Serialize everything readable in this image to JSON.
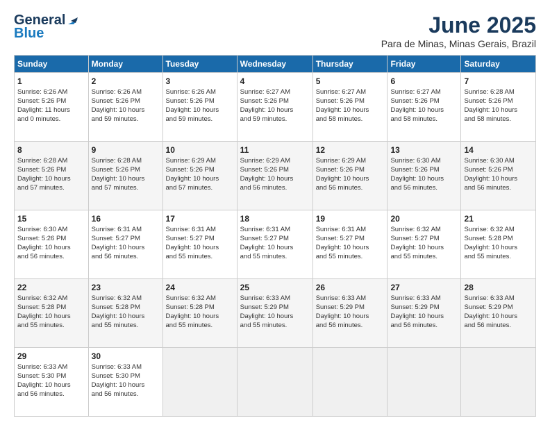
{
  "header": {
    "logo_line1": "General",
    "logo_line2": "Blue",
    "month": "June 2025",
    "location": "Para de Minas, Minas Gerais, Brazil"
  },
  "days_of_week": [
    "Sunday",
    "Monday",
    "Tuesday",
    "Wednesday",
    "Thursday",
    "Friday",
    "Saturday"
  ],
  "weeks": [
    [
      {
        "day": "1",
        "lines": [
          "Sunrise: 6:26 AM",
          "Sunset: 5:26 PM",
          "Daylight: 11 hours",
          "and 0 minutes."
        ]
      },
      {
        "day": "2",
        "lines": [
          "Sunrise: 6:26 AM",
          "Sunset: 5:26 PM",
          "Daylight: 10 hours",
          "and 59 minutes."
        ]
      },
      {
        "day": "3",
        "lines": [
          "Sunrise: 6:26 AM",
          "Sunset: 5:26 PM",
          "Daylight: 10 hours",
          "and 59 minutes."
        ]
      },
      {
        "day": "4",
        "lines": [
          "Sunrise: 6:27 AM",
          "Sunset: 5:26 PM",
          "Daylight: 10 hours",
          "and 59 minutes."
        ]
      },
      {
        "day": "5",
        "lines": [
          "Sunrise: 6:27 AM",
          "Sunset: 5:26 PM",
          "Daylight: 10 hours",
          "and 58 minutes."
        ]
      },
      {
        "day": "6",
        "lines": [
          "Sunrise: 6:27 AM",
          "Sunset: 5:26 PM",
          "Daylight: 10 hours",
          "and 58 minutes."
        ]
      },
      {
        "day": "7",
        "lines": [
          "Sunrise: 6:28 AM",
          "Sunset: 5:26 PM",
          "Daylight: 10 hours",
          "and 58 minutes."
        ]
      }
    ],
    [
      {
        "day": "8",
        "lines": [
          "Sunrise: 6:28 AM",
          "Sunset: 5:26 PM",
          "Daylight: 10 hours",
          "and 57 minutes."
        ]
      },
      {
        "day": "9",
        "lines": [
          "Sunrise: 6:28 AM",
          "Sunset: 5:26 PM",
          "Daylight: 10 hours",
          "and 57 minutes."
        ]
      },
      {
        "day": "10",
        "lines": [
          "Sunrise: 6:29 AM",
          "Sunset: 5:26 PM",
          "Daylight: 10 hours",
          "and 57 minutes."
        ]
      },
      {
        "day": "11",
        "lines": [
          "Sunrise: 6:29 AM",
          "Sunset: 5:26 PM",
          "Daylight: 10 hours",
          "and 56 minutes."
        ]
      },
      {
        "day": "12",
        "lines": [
          "Sunrise: 6:29 AM",
          "Sunset: 5:26 PM",
          "Daylight: 10 hours",
          "and 56 minutes."
        ]
      },
      {
        "day": "13",
        "lines": [
          "Sunrise: 6:30 AM",
          "Sunset: 5:26 PM",
          "Daylight: 10 hours",
          "and 56 minutes."
        ]
      },
      {
        "day": "14",
        "lines": [
          "Sunrise: 6:30 AM",
          "Sunset: 5:26 PM",
          "Daylight: 10 hours",
          "and 56 minutes."
        ]
      }
    ],
    [
      {
        "day": "15",
        "lines": [
          "Sunrise: 6:30 AM",
          "Sunset: 5:26 PM",
          "Daylight: 10 hours",
          "and 56 minutes."
        ]
      },
      {
        "day": "16",
        "lines": [
          "Sunrise: 6:31 AM",
          "Sunset: 5:27 PM",
          "Daylight: 10 hours",
          "and 56 minutes."
        ]
      },
      {
        "day": "17",
        "lines": [
          "Sunrise: 6:31 AM",
          "Sunset: 5:27 PM",
          "Daylight: 10 hours",
          "and 55 minutes."
        ]
      },
      {
        "day": "18",
        "lines": [
          "Sunrise: 6:31 AM",
          "Sunset: 5:27 PM",
          "Daylight: 10 hours",
          "and 55 minutes."
        ]
      },
      {
        "day": "19",
        "lines": [
          "Sunrise: 6:31 AM",
          "Sunset: 5:27 PM",
          "Daylight: 10 hours",
          "and 55 minutes."
        ]
      },
      {
        "day": "20",
        "lines": [
          "Sunrise: 6:32 AM",
          "Sunset: 5:27 PM",
          "Daylight: 10 hours",
          "and 55 minutes."
        ]
      },
      {
        "day": "21",
        "lines": [
          "Sunrise: 6:32 AM",
          "Sunset: 5:28 PM",
          "Daylight: 10 hours",
          "and 55 minutes."
        ]
      }
    ],
    [
      {
        "day": "22",
        "lines": [
          "Sunrise: 6:32 AM",
          "Sunset: 5:28 PM",
          "Daylight: 10 hours",
          "and 55 minutes."
        ]
      },
      {
        "day": "23",
        "lines": [
          "Sunrise: 6:32 AM",
          "Sunset: 5:28 PM",
          "Daylight: 10 hours",
          "and 55 minutes."
        ]
      },
      {
        "day": "24",
        "lines": [
          "Sunrise: 6:32 AM",
          "Sunset: 5:28 PM",
          "Daylight: 10 hours",
          "and 55 minutes."
        ]
      },
      {
        "day": "25",
        "lines": [
          "Sunrise: 6:33 AM",
          "Sunset: 5:29 PM",
          "Daylight: 10 hours",
          "and 55 minutes."
        ]
      },
      {
        "day": "26",
        "lines": [
          "Sunrise: 6:33 AM",
          "Sunset: 5:29 PM",
          "Daylight: 10 hours",
          "and 56 minutes."
        ]
      },
      {
        "day": "27",
        "lines": [
          "Sunrise: 6:33 AM",
          "Sunset: 5:29 PM",
          "Daylight: 10 hours",
          "and 56 minutes."
        ]
      },
      {
        "day": "28",
        "lines": [
          "Sunrise: 6:33 AM",
          "Sunset: 5:29 PM",
          "Daylight: 10 hours",
          "and 56 minutes."
        ]
      }
    ],
    [
      {
        "day": "29",
        "lines": [
          "Sunrise: 6:33 AM",
          "Sunset: 5:30 PM",
          "Daylight: 10 hours",
          "and 56 minutes."
        ]
      },
      {
        "day": "30",
        "lines": [
          "Sunrise: 6:33 AM",
          "Sunset: 5:30 PM",
          "Daylight: 10 hours",
          "and 56 minutes."
        ]
      },
      {
        "day": "",
        "lines": []
      },
      {
        "day": "",
        "lines": []
      },
      {
        "day": "",
        "lines": []
      },
      {
        "day": "",
        "lines": []
      },
      {
        "day": "",
        "lines": []
      }
    ]
  ]
}
